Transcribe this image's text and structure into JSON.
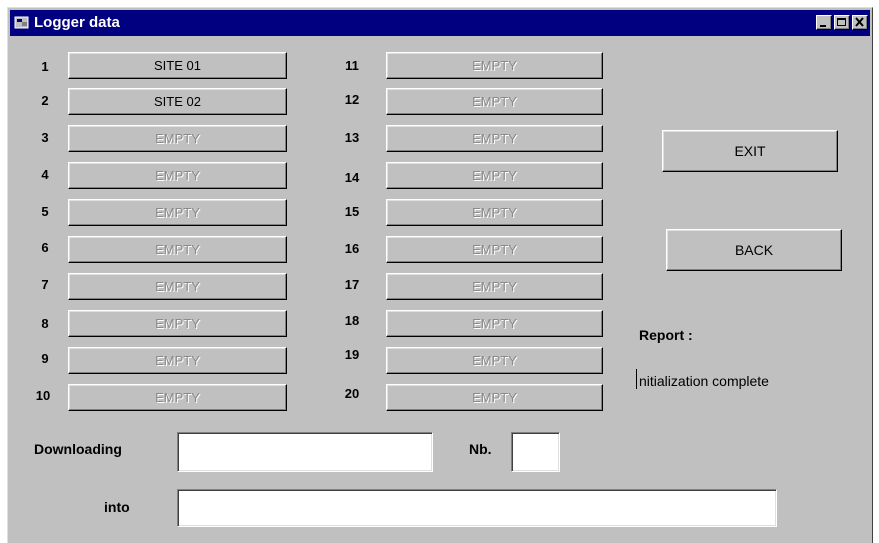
{
  "window": {
    "title": "Logger data",
    "minimize_icon": "minimize-icon",
    "maximize_icon": "maximize-icon",
    "close_icon": "close-icon"
  },
  "sites": [
    {
      "number": "1",
      "label": "SITE 01",
      "enabled": true
    },
    {
      "number": "2",
      "label": "SITE 02",
      "enabled": true
    },
    {
      "number": "3",
      "label": "EMPTY",
      "enabled": false
    },
    {
      "number": "4",
      "label": "EMPTY",
      "enabled": false
    },
    {
      "number": "5",
      "label": "EMPTY",
      "enabled": false
    },
    {
      "number": "6",
      "label": "EMPTY",
      "enabled": false
    },
    {
      "number": "7",
      "label": "EMPTY",
      "enabled": false
    },
    {
      "number": "8",
      "label": "EMPTY",
      "enabled": false
    },
    {
      "number": "9",
      "label": "EMPTY",
      "enabled": false
    },
    {
      "number": "10",
      "label": "EMPTY",
      "enabled": false
    },
    {
      "number": "11",
      "label": "EMPTY",
      "enabled": false
    },
    {
      "number": "12",
      "label": "EMPTY",
      "enabled": false
    },
    {
      "number": "13",
      "label": "EMPTY",
      "enabled": false
    },
    {
      "number": "14",
      "label": "EMPTY",
      "enabled": false
    },
    {
      "number": "15",
      "label": "EMPTY",
      "enabled": false
    },
    {
      "number": "16",
      "label": "EMPTY",
      "enabled": false
    },
    {
      "number": "17",
      "label": "EMPTY",
      "enabled": false
    },
    {
      "number": "18",
      "label": "EMPTY",
      "enabled": false
    },
    {
      "number": "19",
      "label": "EMPTY",
      "enabled": false
    },
    {
      "number": "20",
      "label": "EMPTY",
      "enabled": false
    }
  ],
  "actions": {
    "exit_label": "EXIT",
    "back_label": "BACK"
  },
  "report": {
    "label": "Report :",
    "status": "nitialization complete"
  },
  "download": {
    "downloading_label": "Downloading",
    "downloading_value": "",
    "nb_label": "Nb.",
    "nb_value": "",
    "into_label": "into",
    "into_value": ""
  },
  "colors": {
    "titlebar": "#000080",
    "face": "#c0c0c0",
    "disabled_text": "#8a8a8a"
  }
}
